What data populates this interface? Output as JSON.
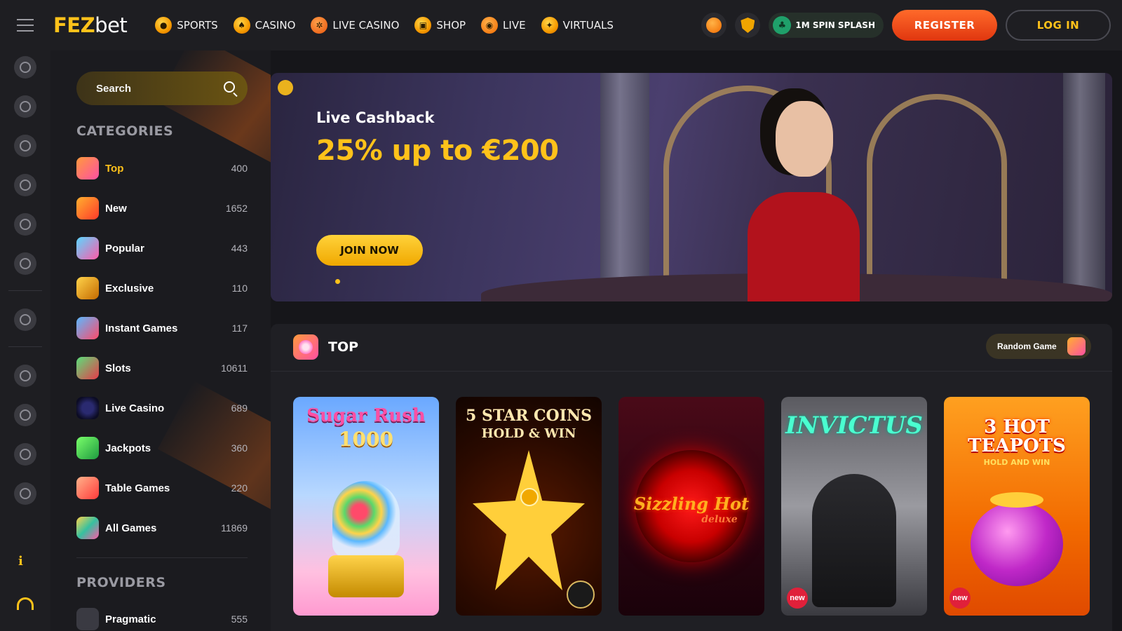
{
  "header": {
    "logo_primary": "FEZ",
    "logo_secondary": "bet",
    "nav": [
      {
        "label": "SPORTS",
        "icon": "soccer-ball-icon"
      },
      {
        "label": "CASINO",
        "icon": "spade-chip-icon"
      },
      {
        "label": "LIVE CASINO",
        "icon": "roulette-wheel-icon"
      },
      {
        "label": "SHOP",
        "icon": "shopping-bag-icon"
      },
      {
        "label": "LIVE",
        "icon": "live-signal-icon"
      },
      {
        "label": "VIRTUALS",
        "icon": "virtual-sports-icon"
      }
    ],
    "promo": "1M SPIN SPLASH",
    "register": "REGISTER",
    "login": "LOG IN"
  },
  "sidebar": {
    "search_placeholder": "Search",
    "categories_title": "CATEGORIES",
    "categories": [
      {
        "label": "Top",
        "count": "400",
        "color": "#ff7ac6"
      },
      {
        "label": "New",
        "count": "1652",
        "color": "#ff5a2a"
      },
      {
        "label": "Popular",
        "count": "443",
        "color": "#ff6fb0"
      },
      {
        "label": "Exclusive",
        "count": "110",
        "color": "#f0a020"
      },
      {
        "label": "Instant Games",
        "count": "117",
        "color": "#4aa0ff"
      },
      {
        "label": "Slots",
        "count": "10611",
        "color": "#e83a4a"
      },
      {
        "label": "Live Casino",
        "count": "689",
        "color": "#2c2c60"
      },
      {
        "label": "Jackpots",
        "count": "360",
        "color": "#2ec45a"
      },
      {
        "label": "Table Games",
        "count": "220",
        "color": "#ff6a3a"
      },
      {
        "label": "All Games",
        "count": "11869",
        "color": "#36c0a0"
      }
    ],
    "providers_title": "PROVIDERS",
    "providers": [
      {
        "label": "Pragmatic",
        "count": "555"
      }
    ]
  },
  "banner": {
    "kicker": "Live Cashback",
    "headline": "25% up to €200",
    "cta": "JOIN NOW"
  },
  "top_section": {
    "title": "TOP",
    "random_button": "Random Game",
    "games": [
      {
        "title_line1": "Sugar Rush",
        "title_line2": "1000",
        "badge": ""
      },
      {
        "title_line1": "5 STAR COINS",
        "title_line2": "HOLD & WIN",
        "badge": ""
      },
      {
        "title_line1": "Sizzling Hot",
        "title_line2": "deluxe",
        "badge": ""
      },
      {
        "title_line1": "INVICTUS",
        "title_line2": "",
        "badge": "new"
      },
      {
        "title_line1": "3 HOT TEAPOTS",
        "title_line2": "HOLD AND WIN",
        "badge": "new"
      }
    ]
  },
  "colors": {
    "accent": "#ffc21a",
    "register": "#f04a1a",
    "background": "#16161a"
  }
}
